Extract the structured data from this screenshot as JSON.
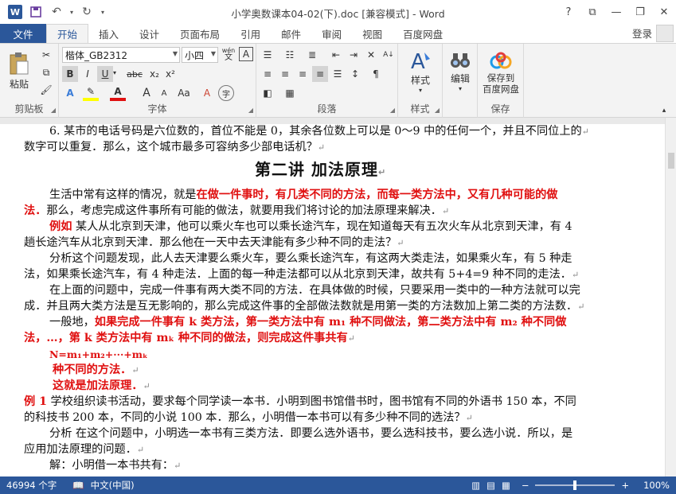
{
  "window": {
    "title": "小学奥数课本04-02(下).doc [兼容模式] - Word",
    "help": "?",
    "minimize": "—",
    "restore": "❐",
    "close": "✕",
    "ribbon_display": "⧉"
  },
  "tabs": {
    "file": "文件",
    "items": [
      "开始",
      "插入",
      "设计",
      "页面布局",
      "引用",
      "邮件",
      "审阅",
      "视图",
      "百度网盘"
    ],
    "login": "登录"
  },
  "ribbon": {
    "clipboard": {
      "label": "剪贴板",
      "paste": "粘贴"
    },
    "font": {
      "label": "字体",
      "font_name": "楷体_GB2312",
      "font_size": "小四",
      "wen": "wén",
      "bold": "B",
      "italic": "I",
      "underline": "U",
      "strike": "abc",
      "sub": "x₂",
      "sup": "x²",
      "grow": "A",
      "shrink": "A",
      "aa": "Aa",
      "clear": "A"
    },
    "paragraph": {
      "label": "段落"
    },
    "styles": {
      "label": "样式",
      "button": "样式"
    },
    "editing": {
      "button": "编辑"
    },
    "save": {
      "label": "保存",
      "button_line1": "保存到",
      "button_line2": "百度网盘"
    }
  },
  "document": {
    "lines": [
      "6. 某市的电话号码是六位数的，首位不能是 0，其余各位数上可以是 0～9 中的任何一个，并且不同位上的",
      "数字可以重复．那么，这个城市最多可容纳多少部电话机？",
      "第二讲  加法原理",
      "生活中常有这样的情况，就是",
      "在做一件事时，有几类不同的方法，而每一类方法中，又有几种可能的做",
      "法．",
      "那么，考虑完成这件事所有可能的做法，就要用我们将讨论的加法原理来解决．",
      "例如",
      " 某人从北京到天津，他可以乘火车也可以乘长途汽车，现在知道每天有五次火车从北京到天津，有 4",
      "趟长途汽车从北京到天津．那么他在一天中去天津能有多少种不同的走法？",
      "分析这个问题发现，此人去天津要么乘火车，要么乘长途汽车，有这两大类走法，如果乘火车，有 5 种走",
      "法，如果乘长途汽车，有 4 种走法．上面的每一种走法都可以从北京到天津，故共有  5+4=9 种不同的走法．",
      "在上面的问题中，完成一件事有两大类不同的方法．在具体做的时候，只要采用一类中的一种方法就可以完",
      "成．并且两大类方法是互无影响的，那么完成这件事的全部做法数就是用第一类的方法数加上第二类的方法数．",
      "一般地，",
      "如果完成一件事有 k 类方法，第一类方法中有 m₁ 种不同做法，第二类方法中有 m₂ 种不同做",
      "法，…，第 k 类方法中有 mₖ 种不同的做法，则完成这件事共有",
      "N=m₁+m₂+···+mₖ",
      "种不同的方法．",
      "这就是加法原理．",
      "例 1",
      " 学校组织读书活动，要求每个同学读一本书．小明到图书馆借书时，图书馆有不同的外语书 150 本，不同",
      "的科技书 200 本，不同的小说 100 本．那么，小明借一本书可以有多少种不同的选法？",
      "分析  在这个问题中，小明选一本书有三类方法．即要么选外语书，要么选科技书，要么选小说．所以，是",
      "应用加法原理的问题．",
      "解：小明借一本书共有："
    ],
    "pilcrow": "↵"
  },
  "status": {
    "word_count": "46994 个字",
    "language": "中文(中国)",
    "zoom": "100%",
    "zoom_minus": "−",
    "zoom_plus": "+"
  },
  "colors": {
    "accent": "#2b579a",
    "emphasis": "#e01010"
  }
}
